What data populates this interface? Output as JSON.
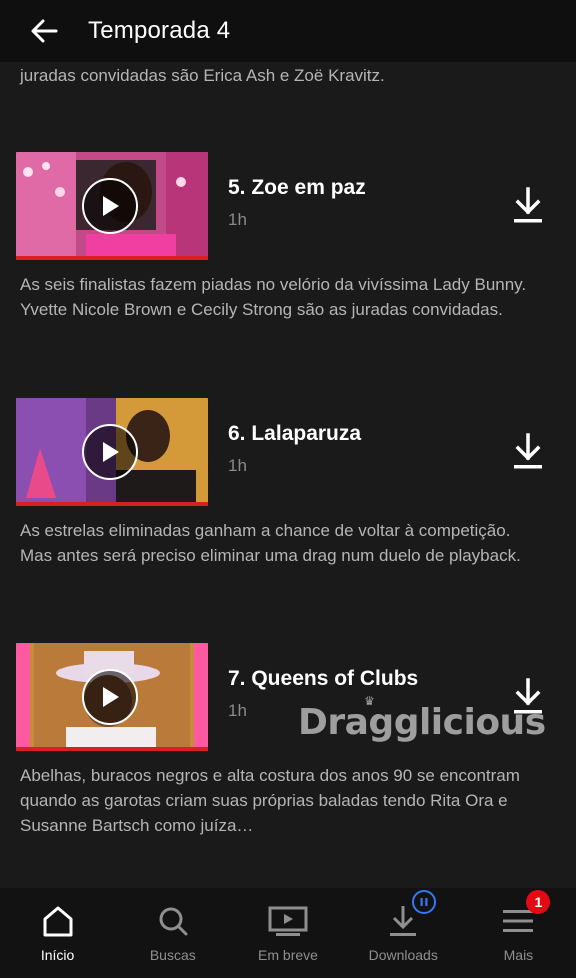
{
  "header": {
    "title": "Temporada 4"
  },
  "previous_episode": {
    "description_tail": "juradas convidadas são Erica Ash e Zoë Kravitz."
  },
  "episodes": [
    {
      "title": "5. Zoe em paz",
      "duration": "1h",
      "description": "As seis finalistas fazem piadas no velório da vivíssima Lady Bunny. Yvette Nicole Brown e Cecily Strong são as juradas convidadas."
    },
    {
      "title": "6. Lalaparuza",
      "duration": "1h",
      "description": "As estrelas eliminadas ganham a chance de voltar à competição. Mas antes será preciso eliminar uma drag num duelo de playback."
    },
    {
      "title": "7. Queens of Clubs",
      "duration": "1h",
      "description": "Abelhas, buracos negros e alta costura dos anos 90 se encontram quando as garotas criam suas próprias baladas tendo Rita Ora e Susanne Bartsch como juíza…"
    }
  ],
  "watermark": "Dragglicious",
  "tabs": [
    {
      "label": "Início",
      "icon": "home-icon",
      "active": true
    },
    {
      "label": "Buscas",
      "icon": "search-icon",
      "active": false
    },
    {
      "label": "Em breve",
      "icon": "coming-soon-icon",
      "active": false
    },
    {
      "label": "Downloads",
      "icon": "downloads-icon",
      "active": false
    },
    {
      "label": "Mais",
      "icon": "menu-icon",
      "active": false,
      "badge": "1"
    }
  ],
  "colors": {
    "accent": "#e50914",
    "progress": "#d81f26",
    "download_badge": "#3478f6"
  }
}
